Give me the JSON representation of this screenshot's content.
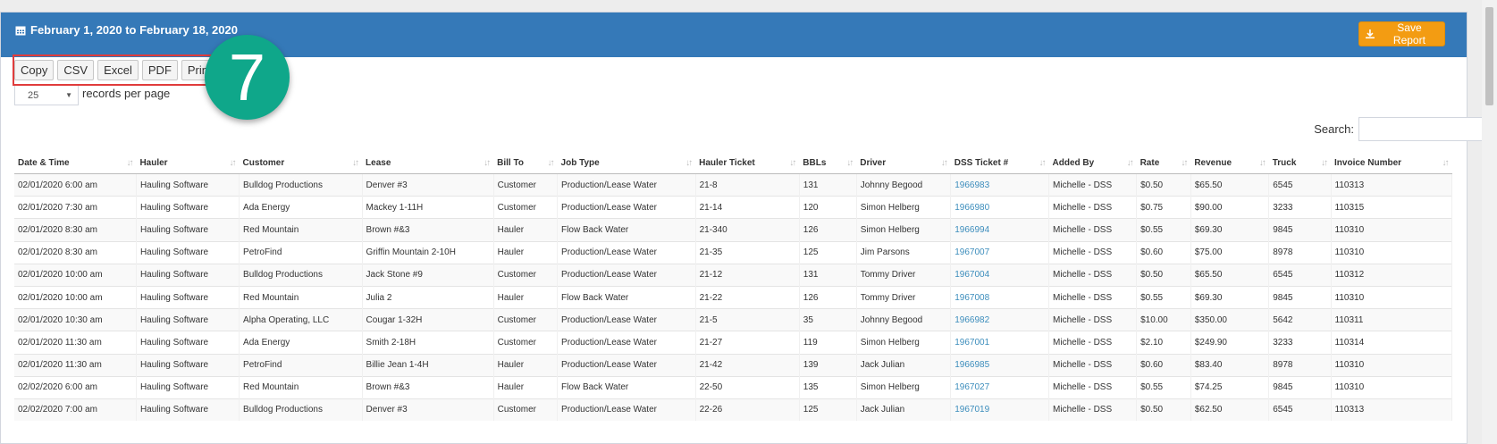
{
  "header": {
    "date_range": "February 1, 2020 to February 18, 2020",
    "save_label": "Save Report"
  },
  "toolbar": {
    "buttons": [
      "Copy",
      "CSV",
      "Excel",
      "PDF",
      "Print"
    ]
  },
  "length": {
    "value": "25",
    "label": "records per page"
  },
  "badge": "7",
  "search": {
    "label": "Search:"
  },
  "colors": {
    "header_bg": "#3579b8",
    "save_bg": "#f39c12",
    "badge_bg": "#0fa78a",
    "highlight_border": "#e03c3c",
    "link": "#3c8dbc"
  },
  "columns": [
    "Date & Time",
    "Hauler",
    "Customer",
    "Lease",
    "Bill To",
    "Job Type",
    "Hauler Ticket",
    "BBLs",
    "Driver",
    "DSS Ticket #",
    "Added By",
    "Rate",
    "Revenue",
    "Truck",
    "Invoice Number"
  ],
  "rows": [
    [
      "02/01/2020 6:00 am",
      "Hauling Software",
      "Bulldog Productions",
      "Denver #3",
      "Customer",
      "Production/Lease Water",
      "21-8",
      "131",
      "Johnny Begood",
      "1966983",
      "Michelle - DSS",
      "$0.50",
      "$65.50",
      "6545",
      "110313"
    ],
    [
      "02/01/2020 7:30 am",
      "Hauling Software",
      "Ada Energy",
      "Mackey 1-11H",
      "Customer",
      "Production/Lease Water",
      "21-14",
      "120",
      "Simon Helberg",
      "1966980",
      "Michelle - DSS",
      "$0.75",
      "$90.00",
      "3233",
      "110315"
    ],
    [
      "02/01/2020 8:30 am",
      "Hauling Software",
      "Red Mountain",
      "Brown #&3",
      "Hauler",
      "Flow Back Water",
      "21-340",
      "126",
      "Simon Helberg",
      "1966994",
      "Michelle - DSS",
      "$0.55",
      "$69.30",
      "9845",
      "110310"
    ],
    [
      "02/01/2020 8:30 am",
      "Hauling Software",
      "PetroFind",
      "Griffin Mountain 2-10H",
      "Hauler",
      "Production/Lease Water",
      "21-35",
      "125",
      "Jim Parsons",
      "1967007",
      "Michelle - DSS",
      "$0.60",
      "$75.00",
      "8978",
      "110310"
    ],
    [
      "02/01/2020 10:00 am",
      "Hauling Software",
      "Bulldog Productions",
      "Jack Stone #9",
      "Customer",
      "Production/Lease Water",
      "21-12",
      "131",
      "Tommy Driver",
      "1967004",
      "Michelle - DSS",
      "$0.50",
      "$65.50",
      "6545",
      "110312"
    ],
    [
      "02/01/2020 10:00 am",
      "Hauling Software",
      "Red Mountain",
      "Julia 2",
      "Hauler",
      "Flow Back Water",
      "21-22",
      "126",
      "Tommy Driver",
      "1967008",
      "Michelle - DSS",
      "$0.55",
      "$69.30",
      "9845",
      "110310"
    ],
    [
      "02/01/2020 10:30 am",
      "Hauling Software",
      "Alpha Operating, LLC",
      "Cougar 1-32H",
      "Customer",
      "Production/Lease Water",
      "21-5",
      "35",
      "Johnny Begood",
      "1966982",
      "Michelle - DSS",
      "$10.00",
      "$350.00",
      "5642",
      "110311"
    ],
    [
      "02/01/2020 11:30 am",
      "Hauling Software",
      "Ada Energy",
      "Smith 2-18H",
      "Customer",
      "Production/Lease Water",
      "21-27",
      "119",
      "Simon Helberg",
      "1967001",
      "Michelle - DSS",
      "$2.10",
      "$249.90",
      "3233",
      "110314"
    ],
    [
      "02/01/2020 11:30 am",
      "Hauling Software",
      "PetroFind",
      "Billie Jean 1-4H",
      "Hauler",
      "Production/Lease Water",
      "21-42",
      "139",
      "Jack Julian",
      "1966985",
      "Michelle - DSS",
      "$0.60",
      "$83.40",
      "8978",
      "110310"
    ],
    [
      "02/02/2020 6:00 am",
      "Hauling Software",
      "Red Mountain",
      "Brown #&3",
      "Hauler",
      "Flow Back Water",
      "22-50",
      "135",
      "Simon Helberg",
      "1967027",
      "Michelle - DSS",
      "$0.55",
      "$74.25",
      "9845",
      "110310"
    ],
    [
      "02/02/2020 7:00 am",
      "Hauling Software",
      "Bulldog Productions",
      "Denver #3",
      "Customer",
      "Production/Lease Water",
      "22-26",
      "125",
      "Jack Julian",
      "1967019",
      "Michelle - DSS",
      "$0.50",
      "$62.50",
      "6545",
      "110313"
    ]
  ]
}
